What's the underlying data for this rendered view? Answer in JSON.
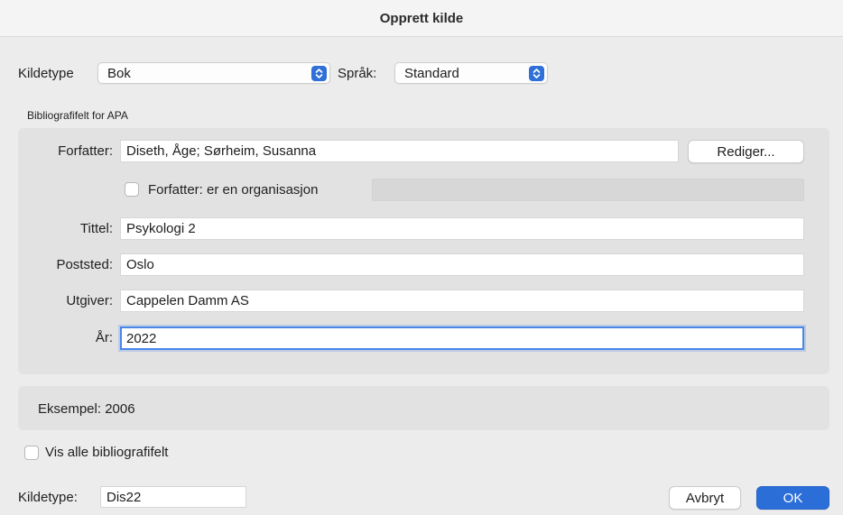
{
  "dialog": {
    "title": "Opprett kilde"
  },
  "top": {
    "source_type_label": "Kildetype",
    "source_type_value": "Bok",
    "language_label": "Språk:",
    "language_value": "Standard"
  },
  "section_caption": "Bibliografifelt for APA",
  "fields": {
    "author_label": "Forfatter:",
    "author_value": "Diseth, Åge; Sørheim, Susanna",
    "edit_button": "Rediger...",
    "org_checkbox_label": "Forfatter: er en organisasjon",
    "title_label": "Tittel:",
    "title_value": "Psykologi 2",
    "city_label": "Poststed:",
    "city_value": "Oslo",
    "publisher_label": "Utgiver:",
    "publisher_value": "Cappelen Damm AS",
    "year_label": "År:",
    "year_value": "2022"
  },
  "example": "Eksempel: 2006",
  "show_all_label": "Vis alle bibliografifelt",
  "footer": {
    "tag_label": "Kildetype:",
    "tag_value": "Dis22",
    "cancel_button": "Avbryt",
    "ok_button": "OK"
  },
  "colors": {
    "accent": "#2c6ed8",
    "focus_ring": "#4a86e8"
  },
  "icons": {
    "popup_chevron": "up-down-chevron-icon"
  }
}
